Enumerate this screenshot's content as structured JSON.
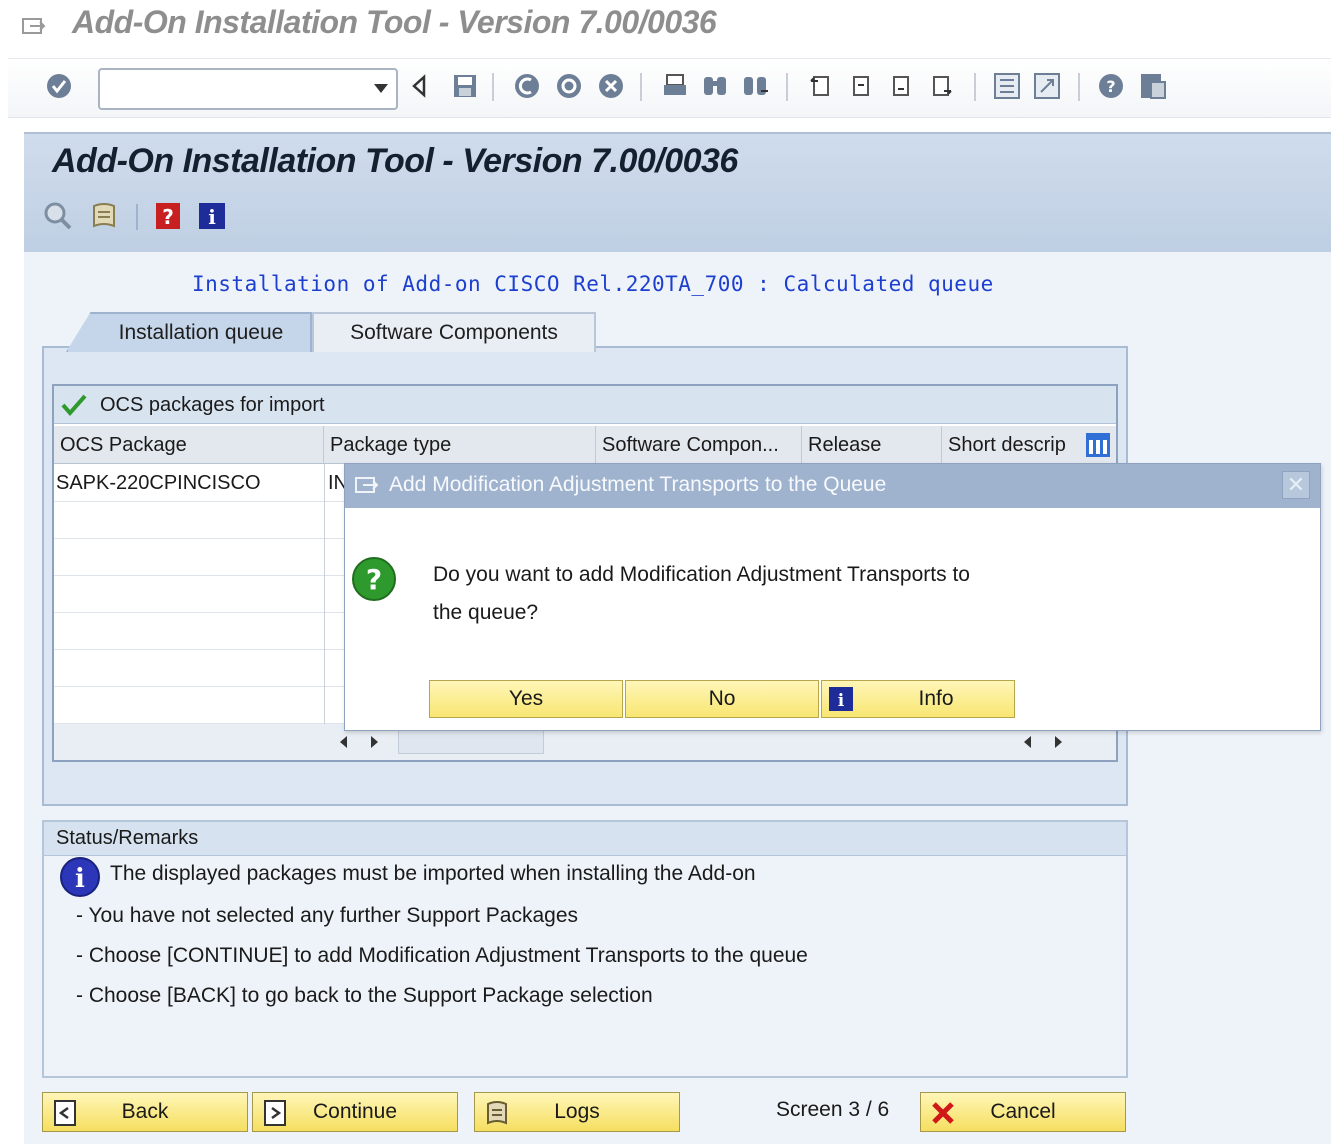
{
  "window": {
    "title": "Add-On Installation Tool - Version 7.00/0036"
  },
  "system_toolbar": {
    "command_field": {
      "value": "",
      "placeholder": ""
    },
    "icons": [
      "enter-icon",
      "back-arrow-icon",
      "save-icon",
      "green-back-icon",
      "exit-icon",
      "cancel-icon",
      "print-icon",
      "find-icon",
      "find-next-icon",
      "first-page-icon",
      "previous-page-icon",
      "next-page-icon",
      "last-page-icon",
      "create-session-icon",
      "shortcut-icon",
      "help-icon",
      "customize-layout-icon"
    ]
  },
  "header": {
    "title": "Add-On Installation Tool - Version 7.00/0036",
    "app_toolbar_icons": [
      "display-icon",
      "log-icon",
      "help-book-icon",
      "info-icon"
    ]
  },
  "main": {
    "subtitle": "Installation of Add-on CISCO Rel.220TA_700 : Calculated queue",
    "tabs": [
      {
        "label": "Installation queue",
        "active": true
      },
      {
        "label": "Software Components",
        "active": false
      }
    ]
  },
  "table": {
    "title": "OCS packages for import",
    "columns": [
      "OCS Package",
      "Package type",
      "Software Compon...",
      "Release",
      "Short descrip"
    ],
    "rows": [
      {
        "package": "SAPK-220CPINCISCO",
        "type": "IN"
      }
    ]
  },
  "dialog": {
    "title": "Add Modification Adjustment Transports to the Queue",
    "message_line1": "Do you want to add Modification Adjustment Transports to",
    "message_line2": "the queue?",
    "buttons": {
      "yes": "Yes",
      "no": "No",
      "info": "Info"
    },
    "close_glyph": "✕"
  },
  "status": {
    "header": "Status/Remarks",
    "lines": [
      "The displayed packages must be imported when installing the Add-on",
      "- You have not selected any further Support Packages",
      "- Choose [CONTINUE] to add Modification Adjustment Transports to the queue",
      "- Choose [BACK] to go back to the Support Package selection"
    ]
  },
  "footer": {
    "back": "Back",
    "continue": "Continue",
    "logs": "Logs",
    "screen": "Screen 3 / 6",
    "cancel": "Cancel"
  },
  "colors": {
    "header_bg": "#c6d6ea",
    "dialog_title_bg": "#9fb3cf",
    "button_yellow": "#f8e672",
    "subtitle_blue": "#1d3fd0",
    "check_green": "#2e9a2e"
  }
}
